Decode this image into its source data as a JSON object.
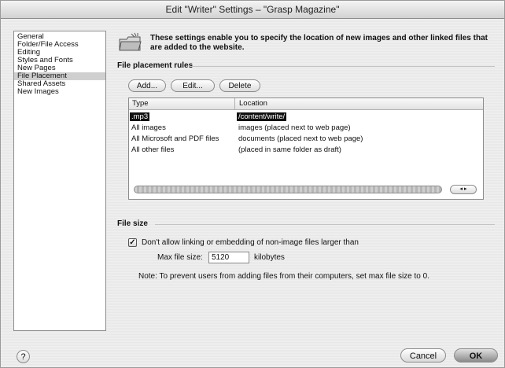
{
  "window": {
    "title": "Edit \"Writer\" Settings – \"Grasp Magazine\""
  },
  "sidebar": {
    "items": [
      {
        "label": "General"
      },
      {
        "label": "Folder/File Access"
      },
      {
        "label": "Editing"
      },
      {
        "label": "Styles and Fonts"
      },
      {
        "label": "New Pages"
      },
      {
        "label": "File Placement",
        "selected": true
      },
      {
        "label": "Shared Assets"
      },
      {
        "label": "New Images"
      }
    ]
  },
  "header": {
    "icon": "folder-icon",
    "text": "These settings enable you to specify the location of new images and other linked files that are added to the website."
  },
  "placement": {
    "section_label": "File placement rules",
    "add_label": "Add...",
    "edit_label": "Edit...",
    "delete_label": "Delete",
    "columns": {
      "type": "Type",
      "location": "Location"
    },
    "rows": [
      {
        "type": ".mp3",
        "location": "/content/write/",
        "selected": true
      },
      {
        "type": "All images",
        "location": "images (placed next to web page)"
      },
      {
        "type": "All Microsoft and PDF files",
        "location": "documents (placed next to web page)"
      },
      {
        "type": "All other files",
        "location": "(placed in same folder as draft)"
      }
    ]
  },
  "filesize": {
    "section_label": "File size",
    "checkbox_label": "Don't allow linking or embedding of non-image files larger than",
    "checkbox_checked": true,
    "max_label": "Max file size:",
    "max_value": "5120",
    "unit": "kilobytes",
    "note": "Note: To prevent users from adding files from their computers, set max file size to 0."
  },
  "footer": {
    "help_label": "?",
    "cancel_label": "Cancel",
    "ok_label": "OK"
  }
}
